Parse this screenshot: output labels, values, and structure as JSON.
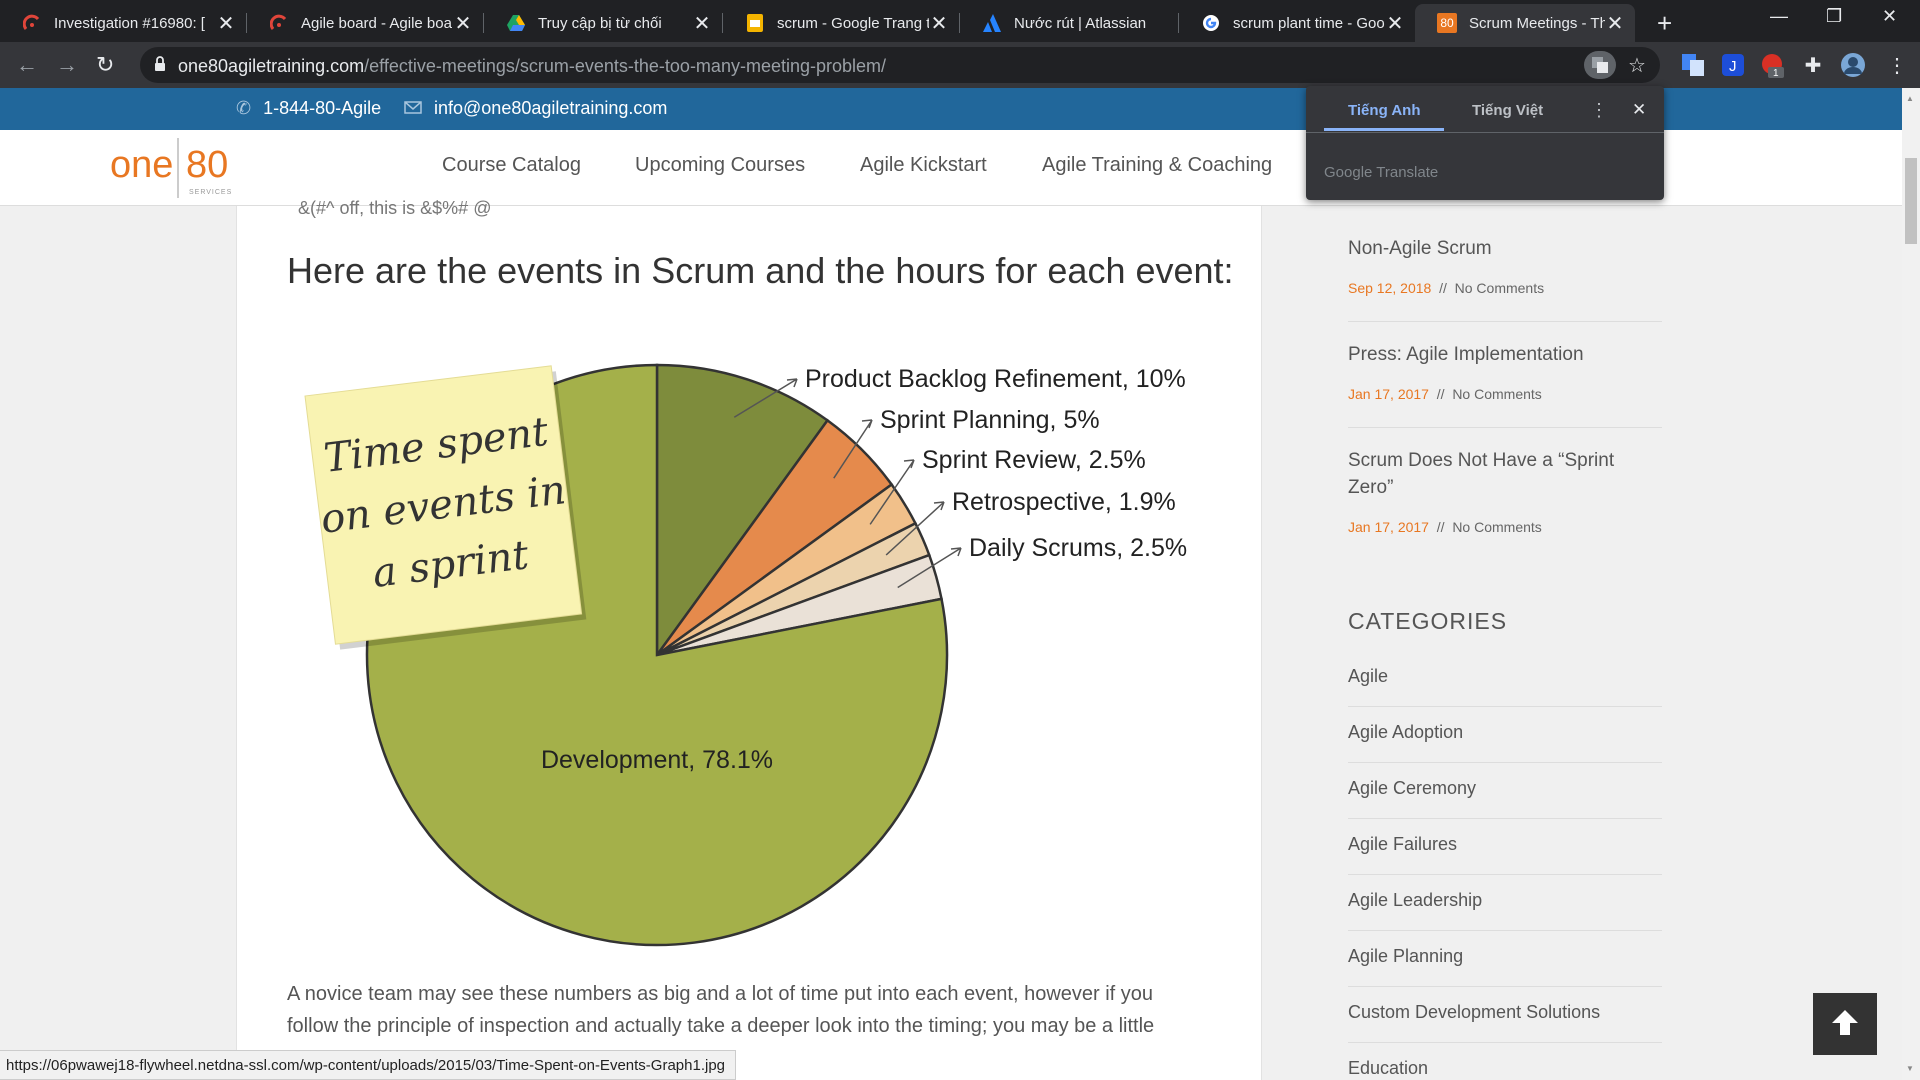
{
  "browser": {
    "tabs": [
      {
        "title": "Investigation #16980: [",
        "icon": "jira-red-icon"
      },
      {
        "title": "Agile board - Agile boa",
        "icon": "jira-red-icon"
      },
      {
        "title": "Truy cập bị từ chối",
        "icon": "google-drive-icon"
      },
      {
        "title": "scrum - Google Trang t",
        "icon": "google-slides-icon"
      },
      {
        "title": "Nước rút | Atlassian",
        "icon": "atlassian-icon"
      },
      {
        "title": "scrum plant time - Goo",
        "icon": "google-icon"
      },
      {
        "title": "Scrum Meetings - The",
        "icon": "one80-favicon-icon",
        "favicon_text": "80"
      }
    ],
    "url_host": "one80agiletraining.com",
    "url_path": "/effective-meetings/scrum-events-the-too-many-meeting-problem/",
    "extension_badge": "1"
  },
  "translate_popup": {
    "tab_source": "Tiếng Anh",
    "tab_target": "Tiếng Việt",
    "footer": "Google Translate"
  },
  "topbar": {
    "phone": "1-844-80-Agile",
    "email": "info@one80agiletraining.com"
  },
  "logo": {
    "one": "one",
    "eighty": "80",
    "sub": "SERVICES"
  },
  "menu": [
    "Course Catalog",
    "Upcoming Courses",
    "Agile Kickstart",
    "Agile Training & Coaching"
  ],
  "article": {
    "cut_line": "&(#^ off, this is &$%# @",
    "heading": "Here are the events in Scrum and the hours for each event:",
    "para_line1": "A novice team may see these numbers as big and a lot of time put into each event, however if you",
    "para_line2": "follow the principle of inspection and actually take a deeper look into the timing; you may be a little"
  },
  "chart_data": {
    "type": "pie",
    "sticky_note": [
      "Time spent",
      "on events in",
      "a sprint"
    ],
    "slices": [
      {
        "label": "Product Backlog Refinement, 10%",
        "value": 10,
        "color": "#7e8c3c"
      },
      {
        "label": "Sprint Planning, 5%",
        "value": 5,
        "color": "#e58a4c"
      },
      {
        "label": "Sprint Review, 2.5%",
        "value": 2.5,
        "color": "#f1c08a"
      },
      {
        "label": "Retrospective, 1.9%",
        "value": 1.9,
        "color": "#ecd3ae"
      },
      {
        "label": "Daily Scrums, 2.5%",
        "value": 2.5,
        "color": "#eae1d7"
      },
      {
        "label": "Development, 78.1%",
        "value": 78.1,
        "color": "#a4b04a"
      }
    ]
  },
  "sidebar": {
    "posts": [
      {
        "title": "Non-Agile Scrum",
        "date": "Sep 12, 2018",
        "sep": "//",
        "comments": "No Comments"
      },
      {
        "title": "Press: Agile Implementation",
        "date": "Jan 17, 2017",
        "sep": "//",
        "comments": "No Comments"
      },
      {
        "title": "Scrum Does Not Have a “Sprint Zero”",
        "date": "Jan 17, 2017",
        "sep": "//",
        "comments": "No Comments"
      }
    ],
    "categories_heading": "CATEGORIES",
    "categories": [
      "Agile",
      "Agile Adoption",
      "Agile Ceremony",
      "Agile Failures",
      "Agile Leadership",
      "Agile Planning",
      "Custom Development Solutions",
      "Education"
    ]
  },
  "status_bar_url": "https://06pwawej18-flywheel.netdna-ssl.com/wp-content/uploads/2015/03/Time-Spent-on-Events-Graph1.jpg"
}
